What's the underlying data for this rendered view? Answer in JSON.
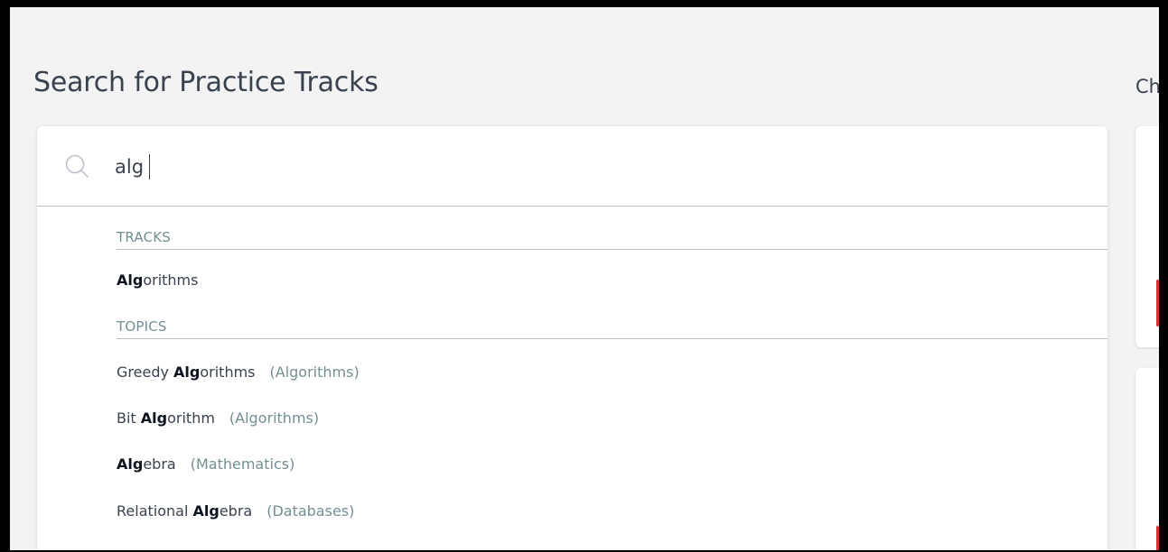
{
  "page": {
    "title": "Search for Practice Tracks",
    "right_heading_partial": "Ch"
  },
  "search": {
    "value": "alg",
    "placeholder": ""
  },
  "dropdown": {
    "sections": [
      {
        "label": "TRACKS",
        "items": [
          {
            "match": "Alg",
            "rest": "orithms",
            "prefix": "",
            "context": ""
          }
        ]
      },
      {
        "label": "TOPICS",
        "items": [
          {
            "prefix": "Greedy ",
            "match": "Alg",
            "rest": "orithms",
            "context": "(Algorithms)"
          },
          {
            "prefix": "Bit ",
            "match": "Alg",
            "rest": "orithm",
            "context": "(Algorithms)"
          },
          {
            "prefix": "",
            "match": "Alg",
            "rest": "ebra",
            "context": "(Mathematics)"
          },
          {
            "prefix": "Relational ",
            "match": "Alg",
            "rest": "ebra",
            "context": "(Databases)"
          }
        ]
      }
    ]
  },
  "icons": {
    "search": "search-icon"
  },
  "colors": {
    "background": "#f3f3f3",
    "text_primary": "#39424e",
    "text_muted": "#738f93",
    "divider": "#b9bec6",
    "accent_red": "#dd3333"
  }
}
